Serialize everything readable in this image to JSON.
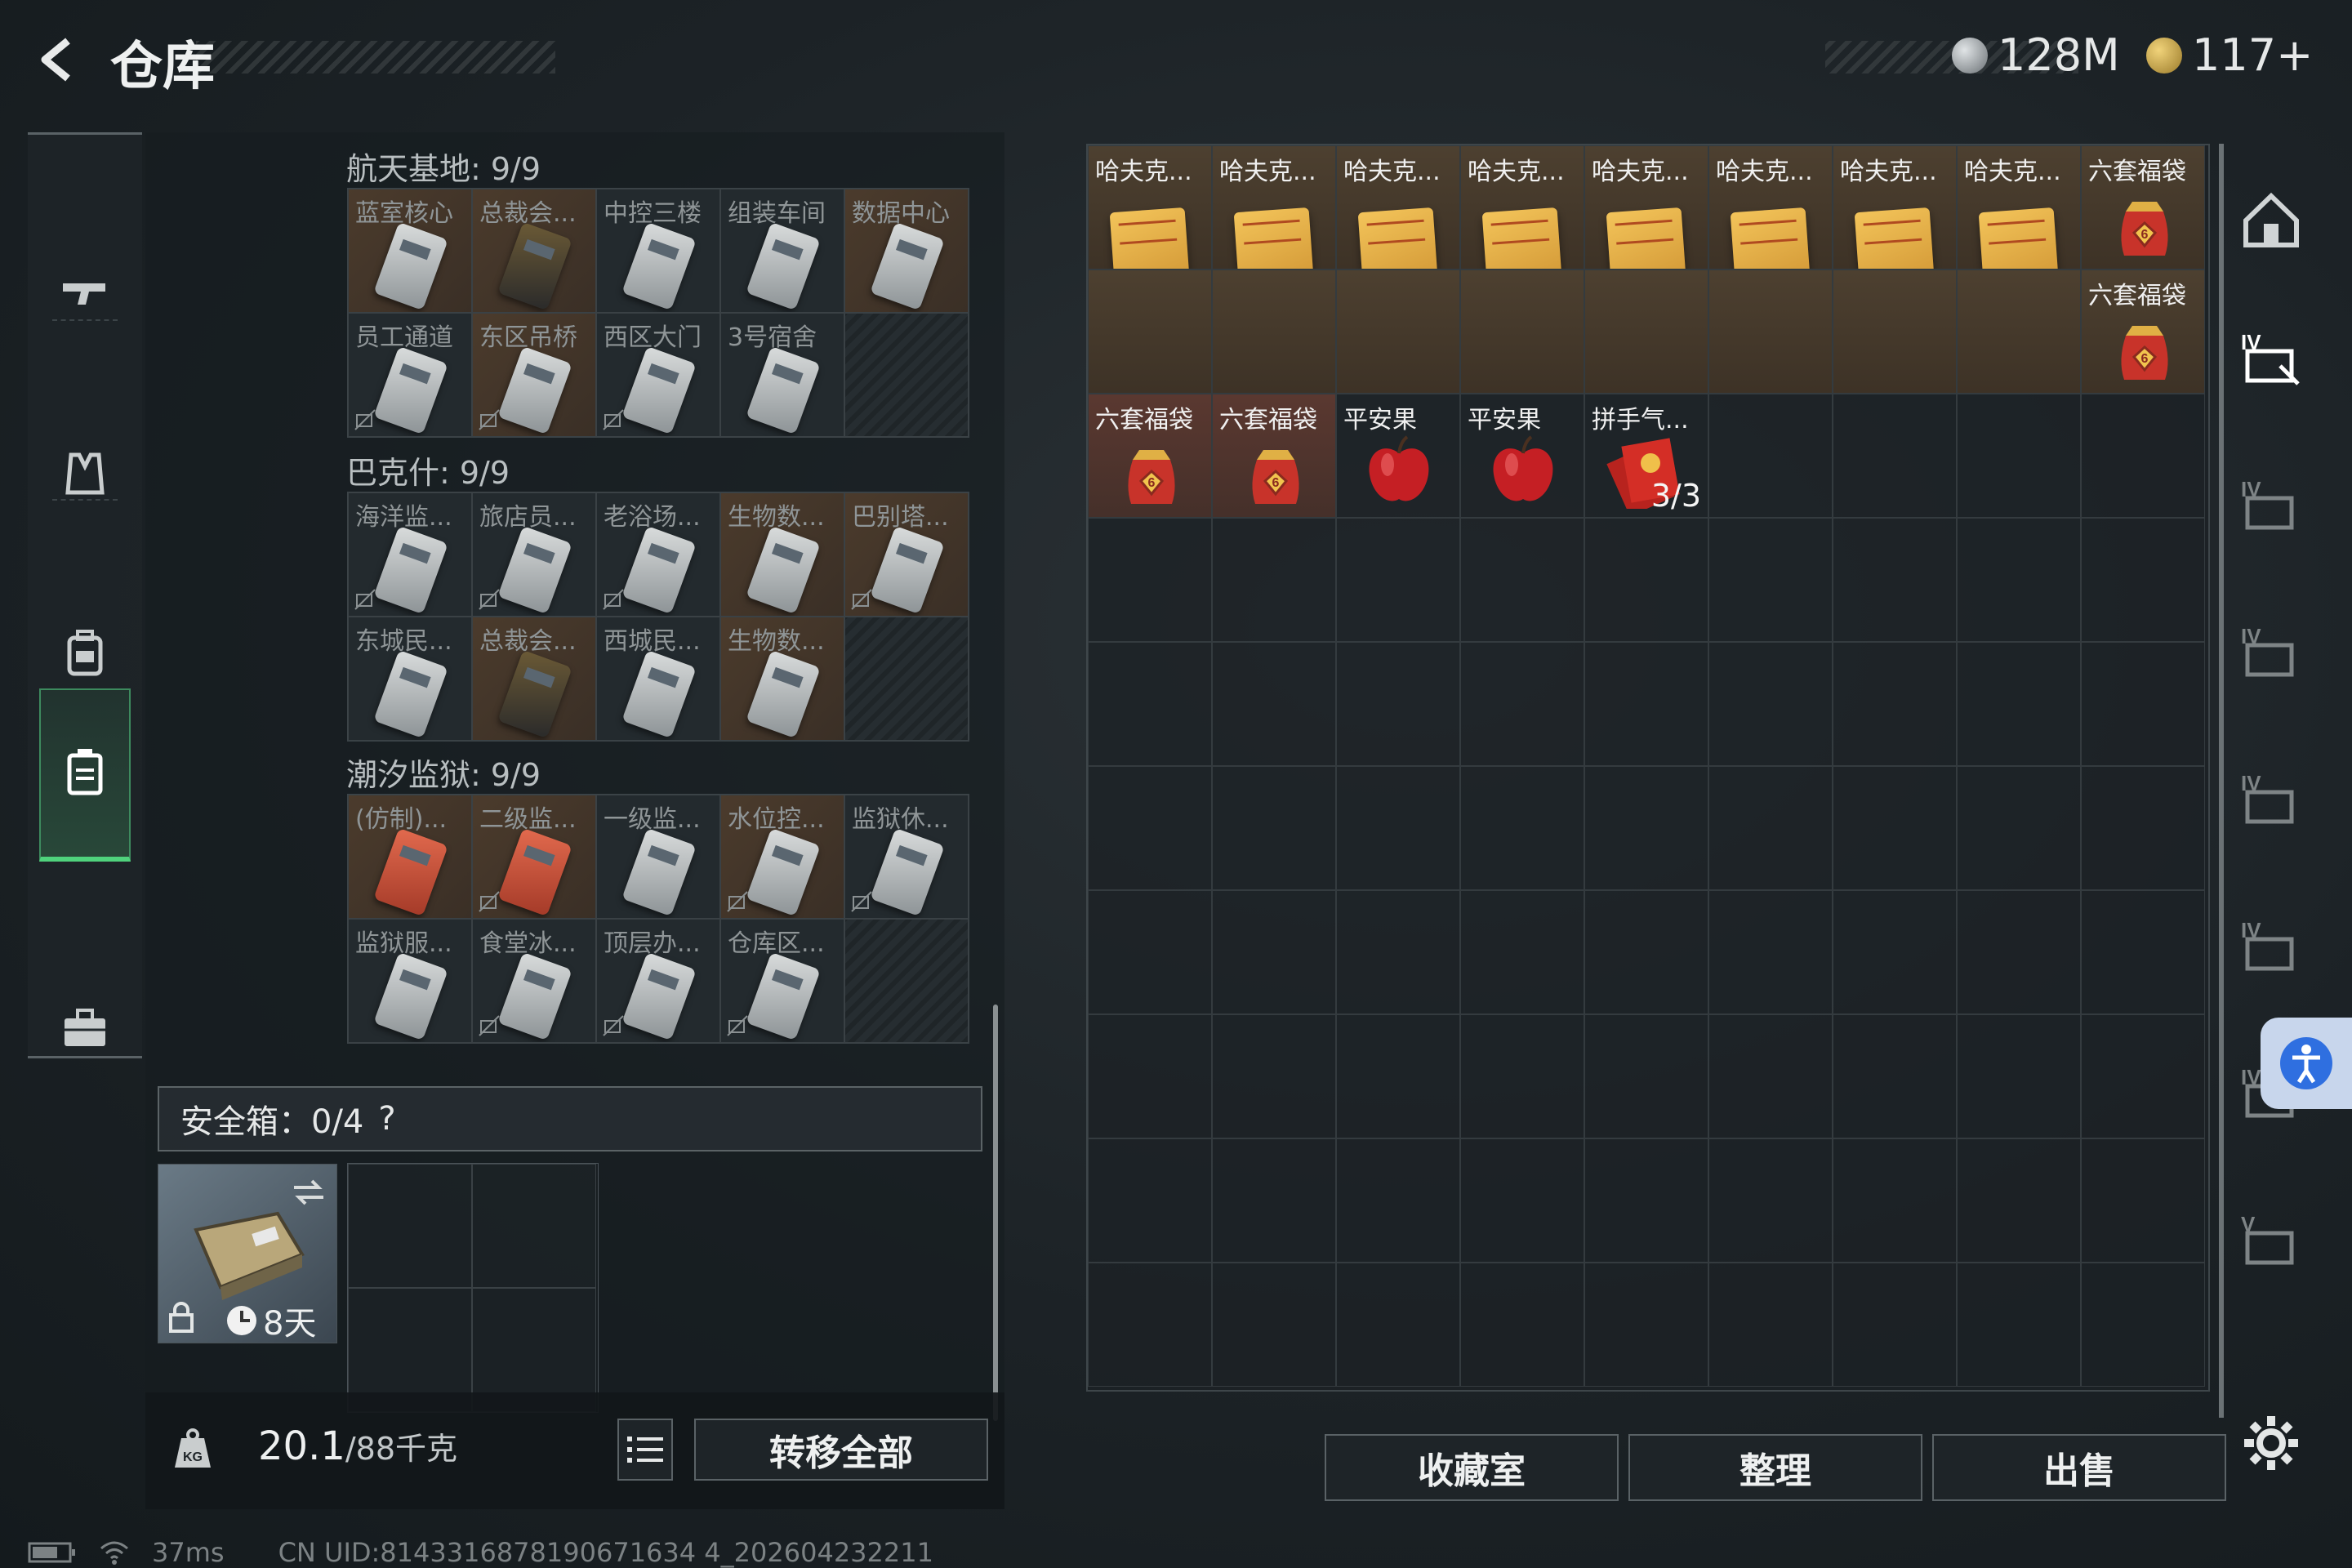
{
  "header": {
    "title": "仓库"
  },
  "currency": {
    "cash": "128M",
    "coins": "117+"
  },
  "left": {
    "sections": [
      {
        "title": "航天基地: 9/9",
        "cells": [
          {
            "name": "蓝室核心",
            "style": "orange",
            "card": "light",
            "lock": false
          },
          {
            "name": "总裁会...",
            "style": "orange",
            "card": "dark",
            "lock": false
          },
          {
            "name": "中控三楼",
            "style": "grey",
            "card": "light",
            "lock": false
          },
          {
            "name": "组装车间",
            "style": "grey",
            "card": "light",
            "lock": false
          },
          {
            "name": "数据中心",
            "style": "orange",
            "card": "light",
            "lock": false
          },
          {
            "name": "员工通道",
            "style": "grey",
            "card": "light",
            "lock": true
          },
          {
            "name": "东区吊桥",
            "style": "orange",
            "card": "light",
            "lock": true
          },
          {
            "name": "西区大门",
            "style": "grey",
            "card": "light",
            "lock": true
          },
          {
            "name": "3号宿舍",
            "style": "grey",
            "card": "light",
            "lock": false
          },
          {
            "name": "",
            "style": "empty",
            "card": "",
            "lock": false
          }
        ]
      },
      {
        "title": "巴克什: 9/9",
        "cells": [
          {
            "name": "海洋监...",
            "style": "grey",
            "card": "light",
            "lock": true
          },
          {
            "name": "旅店员...",
            "style": "grey",
            "card": "light",
            "lock": true
          },
          {
            "name": "老浴场...",
            "style": "grey",
            "card": "light",
            "lock": true
          },
          {
            "name": "生物数...",
            "style": "orange",
            "card": "light",
            "lock": false
          },
          {
            "name": "巴别塔...",
            "style": "orange",
            "card": "light",
            "lock": true
          },
          {
            "name": "东城民...",
            "style": "grey",
            "card": "light",
            "lock": false
          },
          {
            "name": "总裁会...",
            "style": "orange",
            "card": "dark",
            "lock": false
          },
          {
            "name": "西城民...",
            "style": "grey",
            "card": "light",
            "lock": false
          },
          {
            "name": "生物数...",
            "style": "orange",
            "card": "light",
            "lock": false
          },
          {
            "name": "",
            "style": "empty",
            "card": "",
            "lock": false
          }
        ]
      },
      {
        "title": "潮汐监狱: 9/9",
        "cells": [
          {
            "name": "(仿制)...",
            "style": "orange",
            "card": "red",
            "lock": false
          },
          {
            "name": "二级监...",
            "style": "orange",
            "card": "red",
            "lock": true
          },
          {
            "name": "一级监...",
            "style": "grey",
            "card": "light",
            "lock": false
          },
          {
            "name": "水位控...",
            "style": "orange",
            "card": "light",
            "lock": true
          },
          {
            "name": "监狱休...",
            "style": "grey",
            "card": "light",
            "lock": true
          },
          {
            "name": "监狱服...",
            "style": "grey",
            "card": "light",
            "lock": false
          },
          {
            "name": "食堂冰...",
            "style": "grey",
            "card": "light",
            "lock": true
          },
          {
            "name": "顶层办...",
            "style": "grey",
            "card": "light",
            "lock": true
          },
          {
            "name": "仓库区...",
            "style": "grey",
            "card": "light",
            "lock": true
          },
          {
            "name": "",
            "style": "empty",
            "card": "",
            "lock": false
          }
        ]
      }
    ],
    "safe_box": {
      "label": "安全箱：0/4",
      "help": "?",
      "duration": "8天"
    },
    "weight": {
      "current": "20.1",
      "max": "/88千克",
      "unit_icon": "KG"
    },
    "transfer_all": "转移全部"
  },
  "stash": {
    "items": [
      {
        "name": "哈夫克...",
        "kind": "manual",
        "bg": "gold",
        "qty": ""
      },
      {
        "name": "哈夫克...",
        "kind": "manual",
        "bg": "gold",
        "qty": ""
      },
      {
        "name": "哈夫克...",
        "kind": "manual",
        "bg": "gold",
        "qty": ""
      },
      {
        "name": "哈夫克...",
        "kind": "manual",
        "bg": "gold",
        "qty": ""
      },
      {
        "name": "哈夫克...",
        "kind": "manual",
        "bg": "gold",
        "qty": ""
      },
      {
        "name": "哈夫克...",
        "kind": "manual",
        "bg": "gold",
        "qty": ""
      },
      {
        "name": "哈夫克...",
        "kind": "manual",
        "bg": "gold",
        "qty": ""
      },
      {
        "name": "哈夫克...",
        "kind": "manual",
        "bg": "gold",
        "qty": ""
      },
      {
        "name": "六套福袋",
        "kind": "bag",
        "bg": "gold",
        "qty": ""
      },
      {
        "name": "",
        "kind": "",
        "bg": "gold",
        "qty": ""
      },
      {
        "name": "",
        "kind": "",
        "bg": "gold",
        "qty": ""
      },
      {
        "name": "",
        "kind": "",
        "bg": "gold",
        "qty": ""
      },
      {
        "name": "",
        "kind": "",
        "bg": "gold",
        "qty": ""
      },
      {
        "name": "",
        "kind": "",
        "bg": "gold",
        "qty": ""
      },
      {
        "name": "",
        "kind": "",
        "bg": "gold",
        "qty": ""
      },
      {
        "name": "",
        "kind": "",
        "bg": "gold",
        "qty": ""
      },
      {
        "name": "",
        "kind": "",
        "bg": "gold",
        "qty": ""
      },
      {
        "name": "六套福袋",
        "kind": "bag",
        "bg": "gold",
        "qty": ""
      },
      {
        "name": "六套福袋",
        "kind": "bag",
        "bg": "red",
        "qty": ""
      },
      {
        "name": "六套福袋",
        "kind": "bag",
        "bg": "red",
        "qty": ""
      },
      {
        "name": "平安果",
        "kind": "apple",
        "bg": "plain",
        "qty": ""
      },
      {
        "name": "平安果",
        "kind": "apple",
        "bg": "plain",
        "qty": ""
      },
      {
        "name": "拼手气...",
        "kind": "envelope",
        "bg": "plain",
        "qty": "3/3"
      }
    ]
  },
  "bottom": {
    "collection": "收藏室",
    "sort": "整理",
    "sell": "出售"
  },
  "status": {
    "ping": "37ms",
    "uid": "CN UID:8143316878190671634 4_202604232211"
  },
  "right_icons": [
    "home-icon",
    "gear-icon"
  ],
  "colors": {
    "accent_green": "#4fd27c",
    "gold_bg": "#4d4030",
    "red_bg": "#5a3830"
  }
}
